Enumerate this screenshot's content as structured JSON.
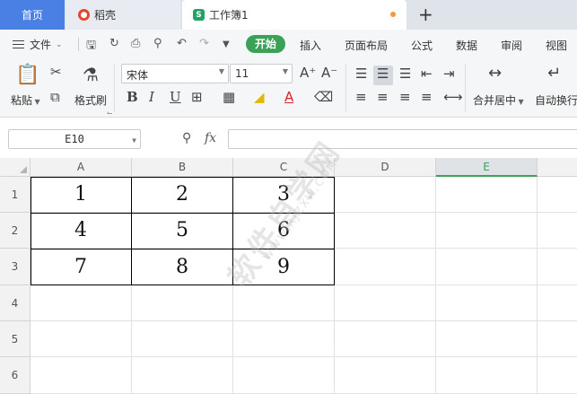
{
  "tabs": {
    "home": "首页",
    "docer": "稻壳",
    "workbook": "工作簿1",
    "add": "+"
  },
  "menu": {
    "file": "文件",
    "items": [
      "开始",
      "插入",
      "页面布局",
      "公式",
      "数据",
      "审阅",
      "视图"
    ]
  },
  "ribbon": {
    "paste": "粘贴",
    "format_painter": "格式刷",
    "font_name": "宋体",
    "font_size": "11",
    "merge_center": "合并居中",
    "auto_wrap": "自动换行"
  },
  "formula_bar": {
    "name_box": "E10",
    "fx": "fx",
    "value": ""
  },
  "sheet": {
    "columns": [
      "A",
      "B",
      "C",
      "D",
      "E"
    ],
    "selected_column": "E",
    "rows": [
      "1",
      "2",
      "3",
      "4",
      "5",
      "6"
    ],
    "cells": [
      [
        "1",
        "2",
        "3"
      ],
      [
        "4",
        "5",
        "6"
      ],
      [
        "7",
        "8",
        "9"
      ]
    ]
  },
  "watermark": {
    "main": "软件自学网",
    "sub": "WWW.RJZXW.COM"
  },
  "colors": {
    "accent_green": "#3aa157",
    "home_tab_blue": "#4a7fe3"
  }
}
